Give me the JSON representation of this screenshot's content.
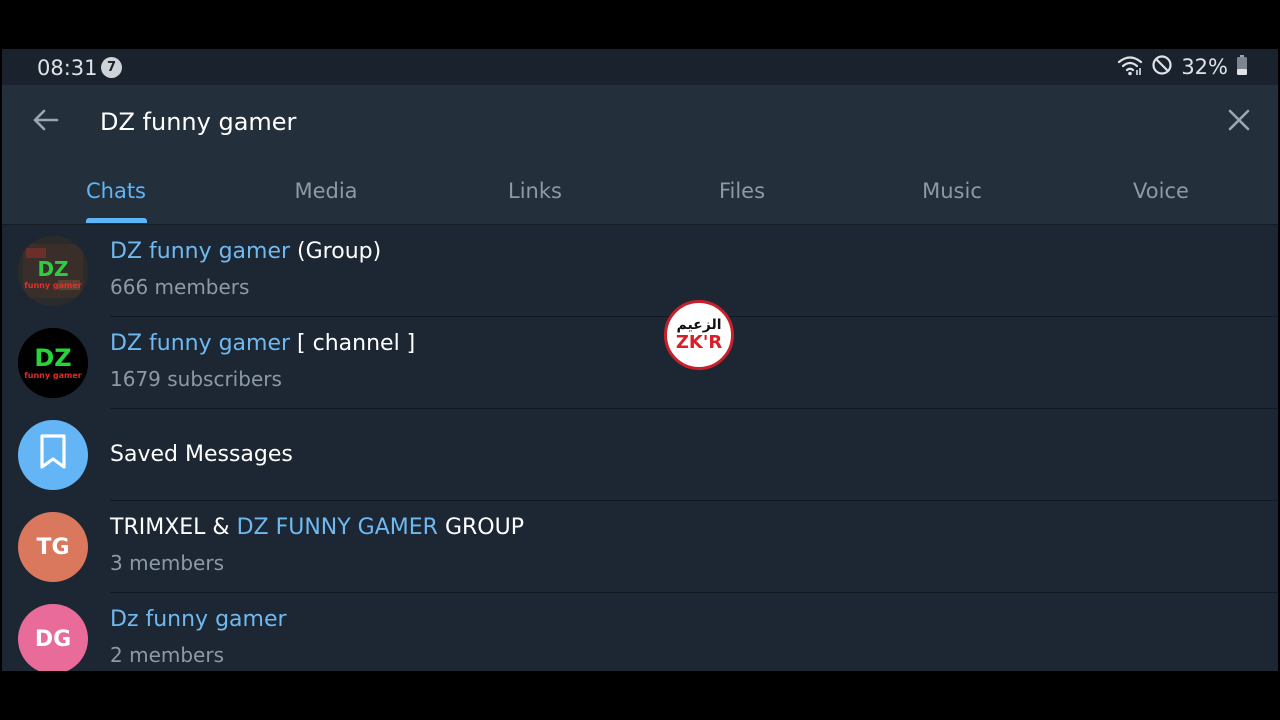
{
  "status_bar": {
    "time": "08:31",
    "notification_count": "7",
    "battery": "32%",
    "icons": [
      "wifi-icon",
      "do-not-disturb-icon",
      "battery-icon"
    ]
  },
  "search": {
    "value": "DZ funny gamer",
    "back_icon": "arrow-left-icon",
    "clear_icon": "close-icon"
  },
  "tabs": [
    {
      "label": "Chats",
      "active": true
    },
    {
      "label": "Media",
      "active": false
    },
    {
      "label": "Links",
      "active": false
    },
    {
      "label": "Files",
      "active": false
    },
    {
      "label": "Music",
      "active": false
    },
    {
      "label": "Voice",
      "active": false
    }
  ],
  "results": [
    {
      "title_highlight": "DZ funny gamer",
      "title_rest": " (Group)",
      "subtitle": "666 members",
      "avatar_text": "DZ",
      "avatar_sub": "funny gamer"
    },
    {
      "title_highlight": "DZ funny gamer",
      "title_rest": " [ channel ]",
      "subtitle": "1679 subscribers",
      "avatar_text": "DZ",
      "avatar_sub": "funny gamer"
    },
    {
      "title": "Saved Messages",
      "avatar_icon": "bookmark-icon"
    },
    {
      "title_pre": "TRIMXEL & ",
      "title_highlight": "DZ FUNNY GAMER",
      "title_rest": " GROUP",
      "subtitle": "3 members",
      "avatar_initials": "TG"
    },
    {
      "title_highlight": "Dz funny gamer",
      "subtitle": "2 members",
      "avatar_initials": "DG"
    }
  ],
  "watermark": {
    "arabic": "الزعيم",
    "latin": "ZK'R"
  },
  "colors": {
    "accent": "#5eb5f7",
    "highlight": "#6fb9f0",
    "background": "#1d2733",
    "header": "#242f3c",
    "saved_avatar": "#64b5f6",
    "tg_avatar": "#d9785c",
    "dg_avatar": "#e86b9a"
  }
}
